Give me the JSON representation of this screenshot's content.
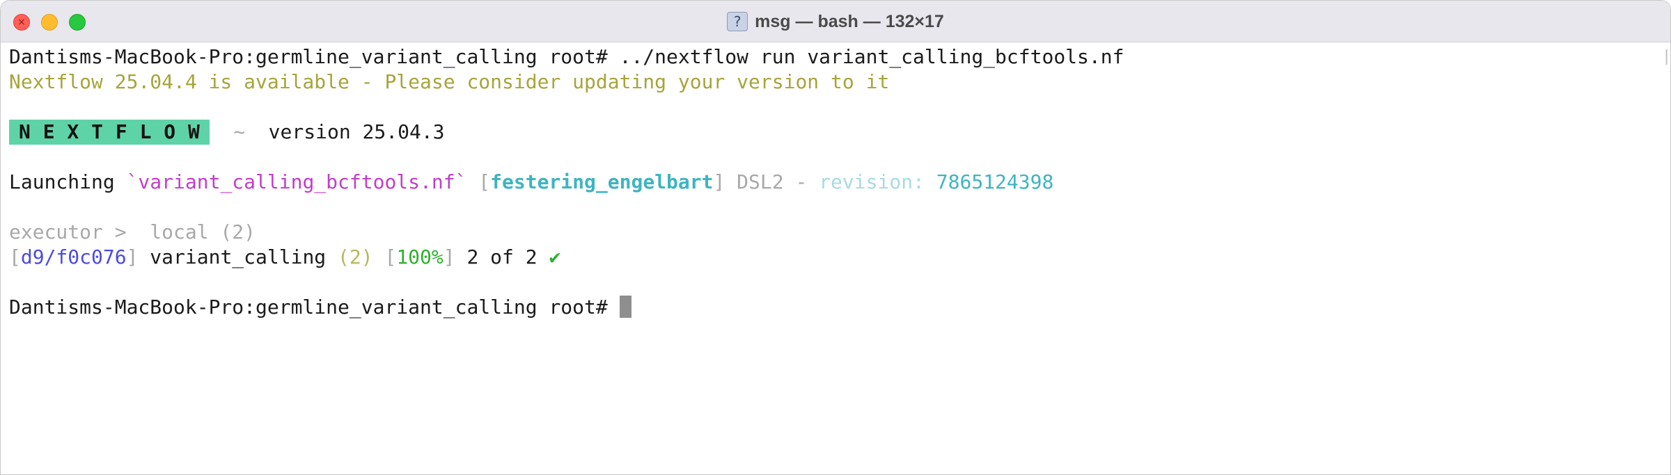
{
  "window": {
    "title": "msg — bash — 132×17",
    "title_icon": "terminal-profile-icon"
  },
  "terminal": {
    "line1": {
      "prompt": "Dantisms-MacBook-Pro:germline_variant_calling root# ",
      "command": "../nextflow run variant_calling_bcftools.nf"
    },
    "line2": {
      "text": "Nextflow 25.04.4 is available - Please consider updating your version to it"
    },
    "line4": {
      "logo": "N E X T F L O W",
      "sep": "  ~  ",
      "version": "version 25.04.3"
    },
    "line6": {
      "launching": "Launching ",
      "script": "`variant_calling_bcftools.nf`",
      "open_bracket": " [",
      "run_name": "festering_engelbart",
      "close_bracket": "]",
      "dsl": " DSL2 - ",
      "revision_label": "revision: ",
      "revision": "7865124398"
    },
    "line8": {
      "executor": "executor >  local (2)"
    },
    "line9": {
      "open_hash": "[",
      "hash": "d9/f0c076",
      "close_hash": "]",
      "process": " variant_calling ",
      "count": "(2)",
      "space": " ",
      "open_pct": "[",
      "percent": "100%",
      "close_pct": "]",
      "progress": " 2 of 2 ",
      "check": "✔"
    },
    "line11": {
      "prompt": "Dantisms-MacBook-Pro:germline_variant_calling root# "
    }
  },
  "colors": {
    "warning": "#a7a43a",
    "script": "#c13ec9",
    "run_name": "#3fb4c1",
    "hash": "#4b4be0",
    "percent": "#2fb12f",
    "logo_bg": "#5fd3a8"
  }
}
